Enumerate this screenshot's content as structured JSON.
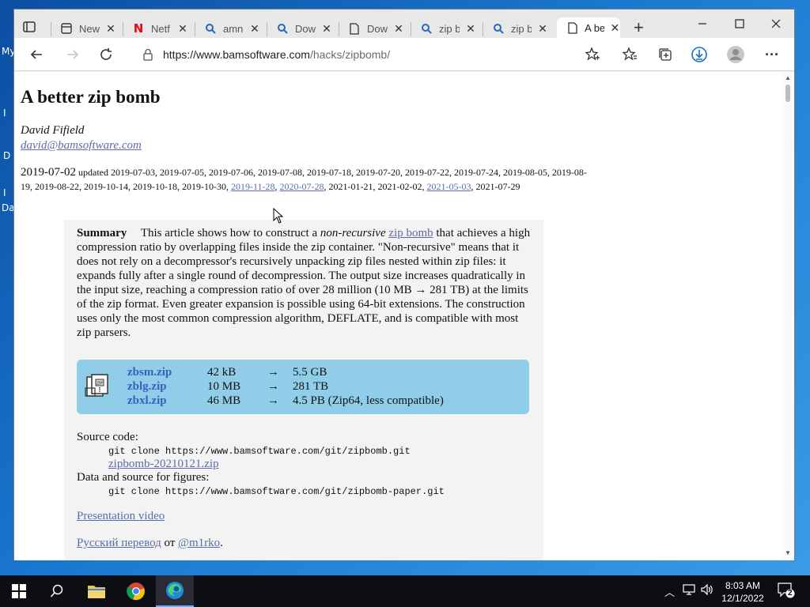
{
  "desktop": {
    "labels": [
      "My",
      "I",
      "D",
      "I",
      "Da"
    ]
  },
  "browser": {
    "tabs": [
      {
        "label": "New",
        "icon": "new-tab-icon"
      },
      {
        "label": "Netf",
        "icon": "netflix-icon"
      },
      {
        "label": "amn",
        "icon": "search-icon"
      },
      {
        "label": "Dow",
        "icon": "search-icon"
      },
      {
        "label": "Dow",
        "icon": "document-icon"
      },
      {
        "label": "zip b",
        "icon": "search-icon"
      },
      {
        "label": "zip b",
        "icon": "search-icon"
      },
      {
        "label": "A be",
        "icon": "document-icon"
      }
    ],
    "new_tab_symbol": "+",
    "url": {
      "host": "https://www.bamsoftware.com",
      "path": "/hacks/zipbomb/"
    }
  },
  "page": {
    "title": "A better zip bomb",
    "author": "David Fifield",
    "email": "david@bamsoftware.com",
    "date": "2019-07-02",
    "updated_prefix": "updated",
    "updated_plain": "2019-07-03, 2019-07-05, 2019-07-06, 2019-07-08, 2019-07-18, 2019-07-20, 2019-07-22, 2019-07-24, 2019-08-05, 2019-08-19, 2019-08-22, 2019-10-14, 2019-10-18, 2019-10-30,",
    "updated_link1": "2019-11-28",
    "updated_link2": "2020-07-28",
    "updated_mid": "2021-01-21, 2021-02-02,",
    "updated_link3": "2021-05-03",
    "updated_last": "2021-07-29",
    "summary_heading": "Summary",
    "summary_part1": "This article shows how to construct a",
    "summary_em": "non-recursive",
    "summary_link": "zip bomb",
    "summary_part2": "that achieves a high compression ratio by overlapping files inside the zip container. \"Non-recursive\" means that it does not rely on a decompressor's recursively unpacking zip files nested within zip files: it expands fully after a single round of decompression. The output size increases quadratically in the input size, reaching a compression ratio of over 28 million (10 MB → 281 TB) at the limits of the zip format. Even greater expansion is possible using 64-bit extensions. The construction uses only the most common compression algorithm, DEFLATE, and is compatible with most zip parsers.",
    "files": [
      {
        "name": "zbsm.zip",
        "size": "42 kB",
        "arrow": "→",
        "result": "5.5 GB"
      },
      {
        "name": "zblg.zip",
        "size": "10 MB",
        "arrow": "→",
        "result": "281 TB"
      },
      {
        "name": "zbxl.zip",
        "size": "46 MB",
        "arrow": "→",
        "result": "4.5 PB (Zip64, less compatible)"
      }
    ],
    "source_label": "Source code:",
    "source_cmd": "git clone https://www.bamsoftware.com/git/zipbomb.git",
    "source_zip": "zipbomb-20210121.zip",
    "figures_label": "Data and source for figures:",
    "figures_cmd": "git clone https://www.bamsoftware.com/git/zipbomb-paper.git",
    "video_link": "Presentation video",
    "translation_link": "Русский перевод",
    "translation_by": "от",
    "translation_author": "@m1rko",
    "translation_end": "."
  },
  "taskbar": {
    "time": "8:03 AM",
    "date": "12/1/2022",
    "notifications": "2"
  },
  "colors": {
    "link": "#5b6cad",
    "file_box": "#8fcde8",
    "file_name": "#3b5fbf",
    "taskbar": "#0d0d14"
  }
}
